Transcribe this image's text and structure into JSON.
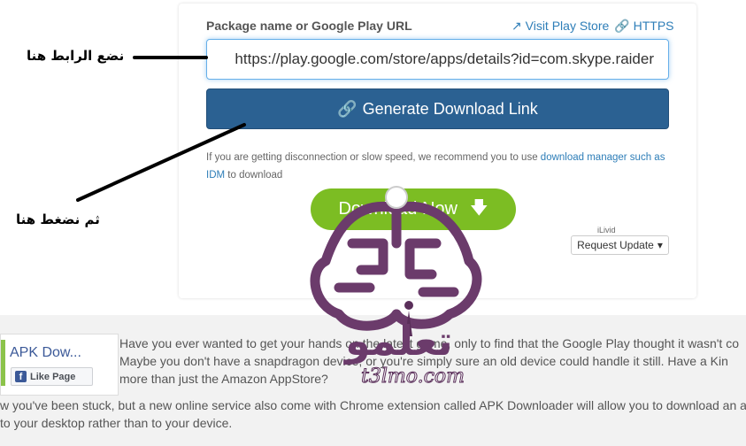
{
  "form": {
    "label": "Package name or Google Play URL",
    "visit_link": "Visit Play Store",
    "https_link": "HTTPS",
    "url_value": "https://play.google.com/store/apps/details?id=com.skype.raider",
    "generate_label": "Generate Download Link",
    "note_text": "If you are getting disconnection or slow speed, we recommend you to use ",
    "note_link": "download manager such as IDM",
    "note_tail": " to download",
    "download_label": "Download Now",
    "ilivid": "iLivid",
    "request_label": "Request Update"
  },
  "annotations": {
    "put_link": "نضع الرابط هنا",
    "then_click": "ثم نضغط هنا"
  },
  "facebook": {
    "page_name": "APK Dow...",
    "like_label": "Like Page"
  },
  "article": {
    "line1": "Have you ever wanted to get your hands on the latest game, only to find that the Google Play thought it wasn't co",
    "line2": "Maybe you don't have a snapdragon device, or you're simply sure an old device could handle it still. Have a Kin",
    "line3": "more than just the Amazon AppStore?",
    "line4": "w you've been stuck, but a new online service also come with Chrome extension called APK Downloader will allow you to download an a",
    "line5": "to your desktop rather than to your device."
  },
  "watermark": {
    "brand": "تعلمو",
    "site": "t3lmo.com"
  },
  "colors": {
    "primary": "#2b6192",
    "success": "#7cbd23",
    "link": "#2e7eb8",
    "brand": "#6b3b6b"
  }
}
